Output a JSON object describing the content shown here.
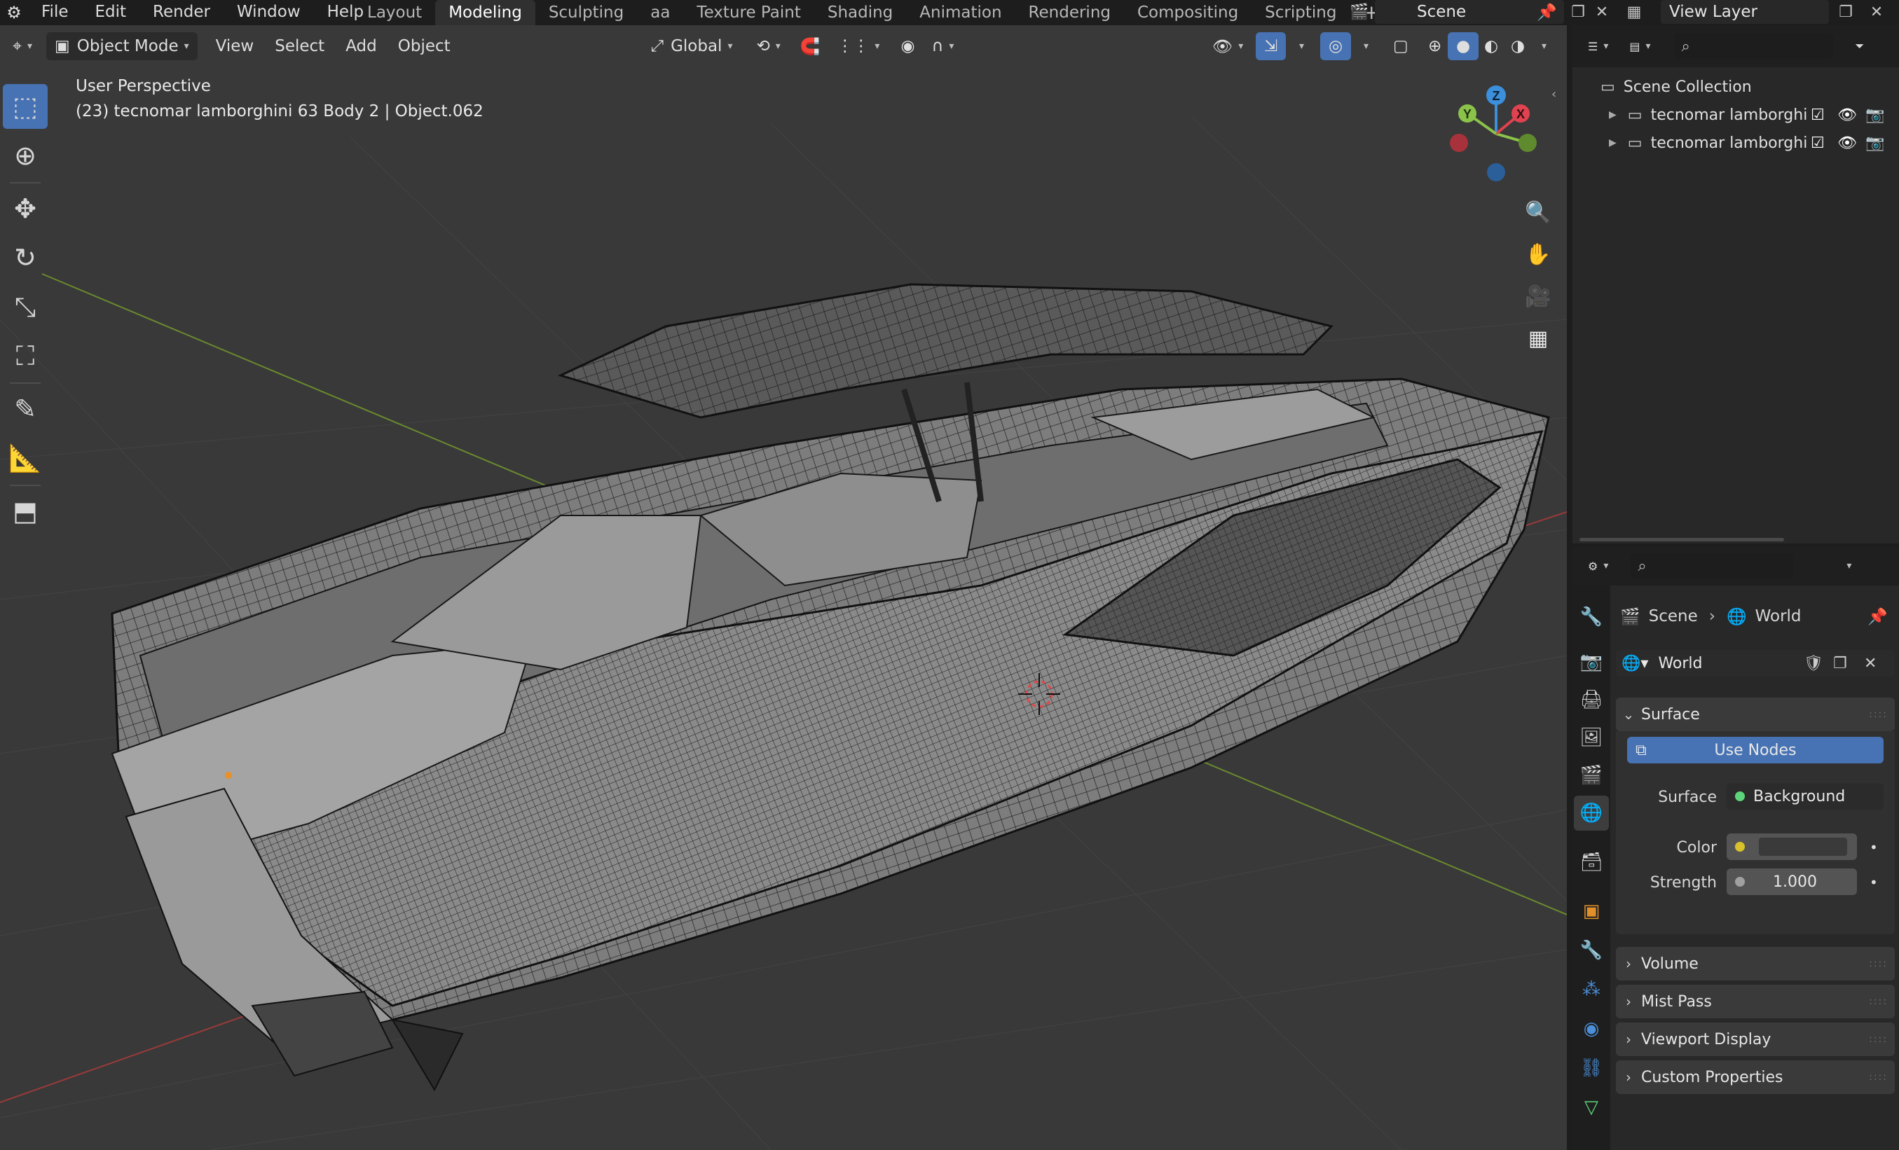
{
  "menu": [
    "File",
    "Edit",
    "Render",
    "Window",
    "Help"
  ],
  "workspaces": [
    "Layout",
    "Modeling",
    "Sculpting",
    "aa",
    "Texture Paint",
    "Shading",
    "Animation",
    "Rendering",
    "Compositing",
    "Scripting"
  ],
  "active_workspace": "Modeling",
  "scene_name": "Scene",
  "view_layer": "View Layer",
  "viewport": {
    "mode": "Object Mode",
    "menus": [
      "View",
      "Select",
      "Add",
      "Object"
    ],
    "transform_orientation": "Global",
    "perspective_label": "User Perspective",
    "object_info": "(23) tecnomar lamborghini 63 Body 2 | Object.062",
    "gizmo_axes": {
      "x": "X",
      "y": "Y",
      "z": "Z"
    }
  },
  "outliner": {
    "root": "Scene Collection",
    "items": [
      "tecnomar lamborghi",
      "tecnomar lamborghi"
    ]
  },
  "properties": {
    "breadcrumb": {
      "scene": "Scene",
      "world": "World"
    },
    "datablock": "World",
    "surface_section": "Surface",
    "use_nodes_label": "Use Nodes",
    "surface_label": "Surface",
    "surface_value": "Background",
    "color_label": "Color",
    "strength_label": "Strength",
    "strength_value": "1.000",
    "collapsed_sections": [
      "Volume",
      "Mist Pass",
      "Viewport Display",
      "Custom Properties"
    ]
  },
  "colors": {
    "accent": "#4772b3",
    "axis_x": "#e0424f",
    "axis_y": "#8bc34a",
    "axis_z": "#3b8fdb",
    "color_swatch": "#d8c22b"
  }
}
